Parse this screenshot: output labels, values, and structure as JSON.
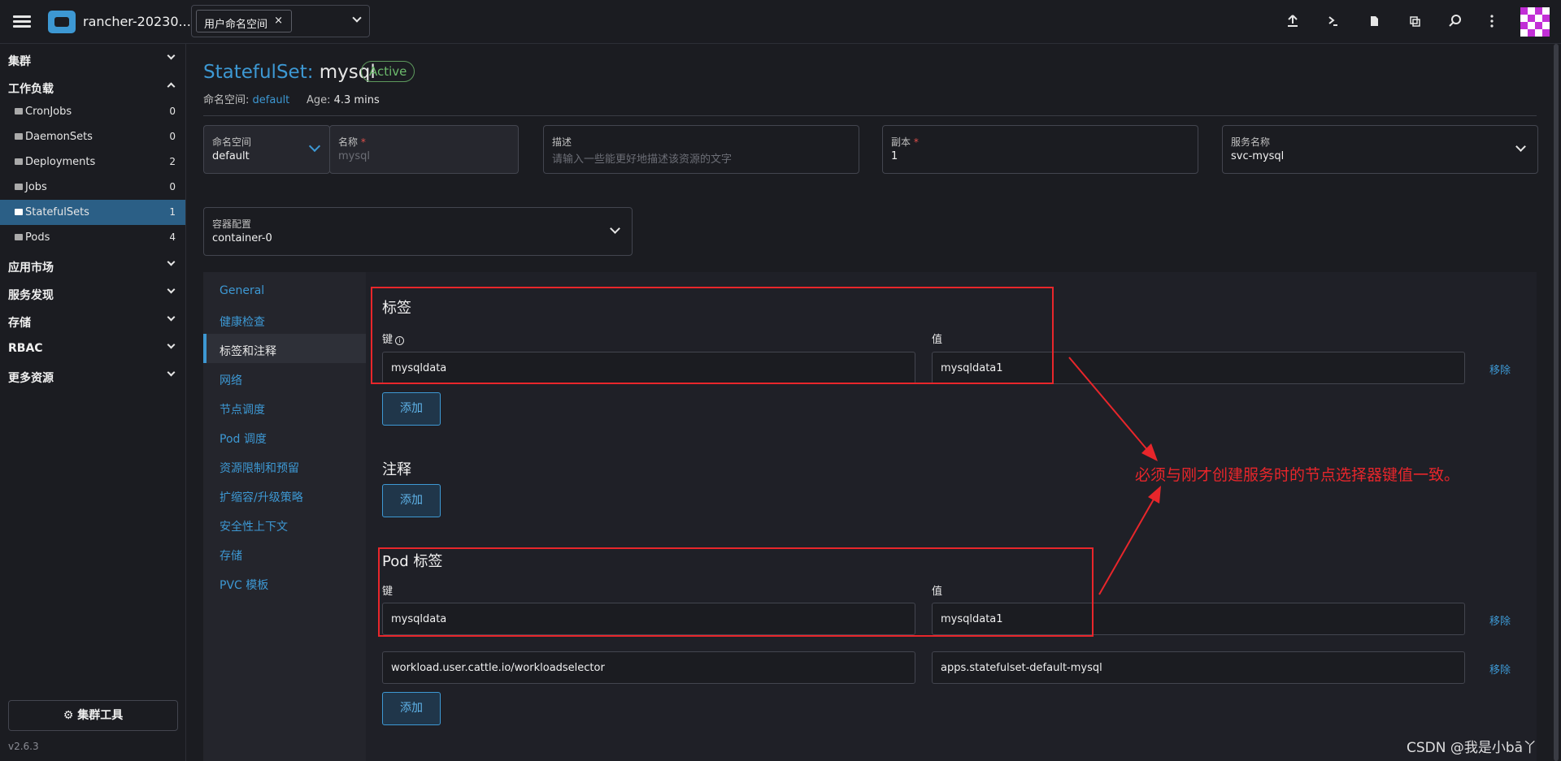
{
  "header": {
    "cluster_name": "rancher-20230...",
    "namespace_chip": "用户命名空间",
    "chip_close": "×"
  },
  "sidebar": {
    "groups": [
      "集群",
      "工作负载",
      "应用市场",
      "服务发现",
      "存储",
      "RBAC",
      "更多资源"
    ],
    "items": [
      {
        "label": "CronJobs",
        "count": "0"
      },
      {
        "label": "DaemonSets",
        "count": "0"
      },
      {
        "label": "Deployments",
        "count": "2"
      },
      {
        "label": "Jobs",
        "count": "0"
      },
      {
        "label": "StatefulSets",
        "count": "1"
      },
      {
        "label": "Pods",
        "count": "4"
      }
    ],
    "tools_button": "⚙ 集群工具",
    "version": "v2.6.3"
  },
  "page": {
    "kind": "StatefulSet:",
    "name": "mysql",
    "state": "Active",
    "ns_label": "命名空间:",
    "ns_value": "default",
    "age_label": "Age:",
    "age_value": "4.3 mins"
  },
  "form": {
    "namespace_label": "命名空间",
    "namespace_value": "default",
    "name_label": "名称",
    "name_placeholder": "mysql",
    "desc_label": "描述",
    "desc_placeholder": "请输入一些能更好地描述该资源的文字",
    "replicas_label": "副本",
    "replicas_value": "1",
    "service_label": "服务名称",
    "service_value": "svc-mysql",
    "container_label": "容器配置",
    "container_value": "container-0",
    "required_mark": "*"
  },
  "tabs": [
    "General",
    "健康检查",
    "标签和注释",
    "网络",
    "节点调度",
    "Pod 调度",
    "资源限制和预留",
    "扩缩容/升级策略",
    "安全性上下文",
    "存储",
    "PVC 模板"
  ],
  "labels_section": {
    "title": "标签",
    "key_header": "键",
    "value_header": "值",
    "rows": [
      {
        "key": "mysqldata",
        "value": "mysqldata1",
        "remove": "移除"
      }
    ],
    "add": "添加"
  },
  "annotations_section": {
    "title": "注释",
    "add": "添加"
  },
  "pod_labels_section": {
    "title": "Pod 标签",
    "key_header": "键",
    "value_header": "值",
    "rows": [
      {
        "key": "mysqldata",
        "value": "mysqldata1",
        "remove": "移除"
      },
      {
        "key": "workload.user.cattle.io/workloadselector",
        "value": "apps.statefulset-default-mysql",
        "remove": "移除"
      }
    ],
    "add": "添加"
  },
  "annotation_text": "必须与刚才创建服务时的节点选择器键值一致。",
  "watermark": "CSDN @我是小bā丫",
  "colors": {
    "accent": "#3d98d3",
    "active_badge": "#6dbb6d",
    "annotation_red": "#e8262b"
  },
  "icons": [
    "menu-icon",
    "rancher-logo-icon",
    "upload-icon",
    "shell-icon",
    "file-icon",
    "copy-icon",
    "search-icon",
    "more-vertical-icon",
    "avatar",
    "gear-icon",
    "folder-icon",
    "info-icon",
    "chevron-down-icon"
  ]
}
